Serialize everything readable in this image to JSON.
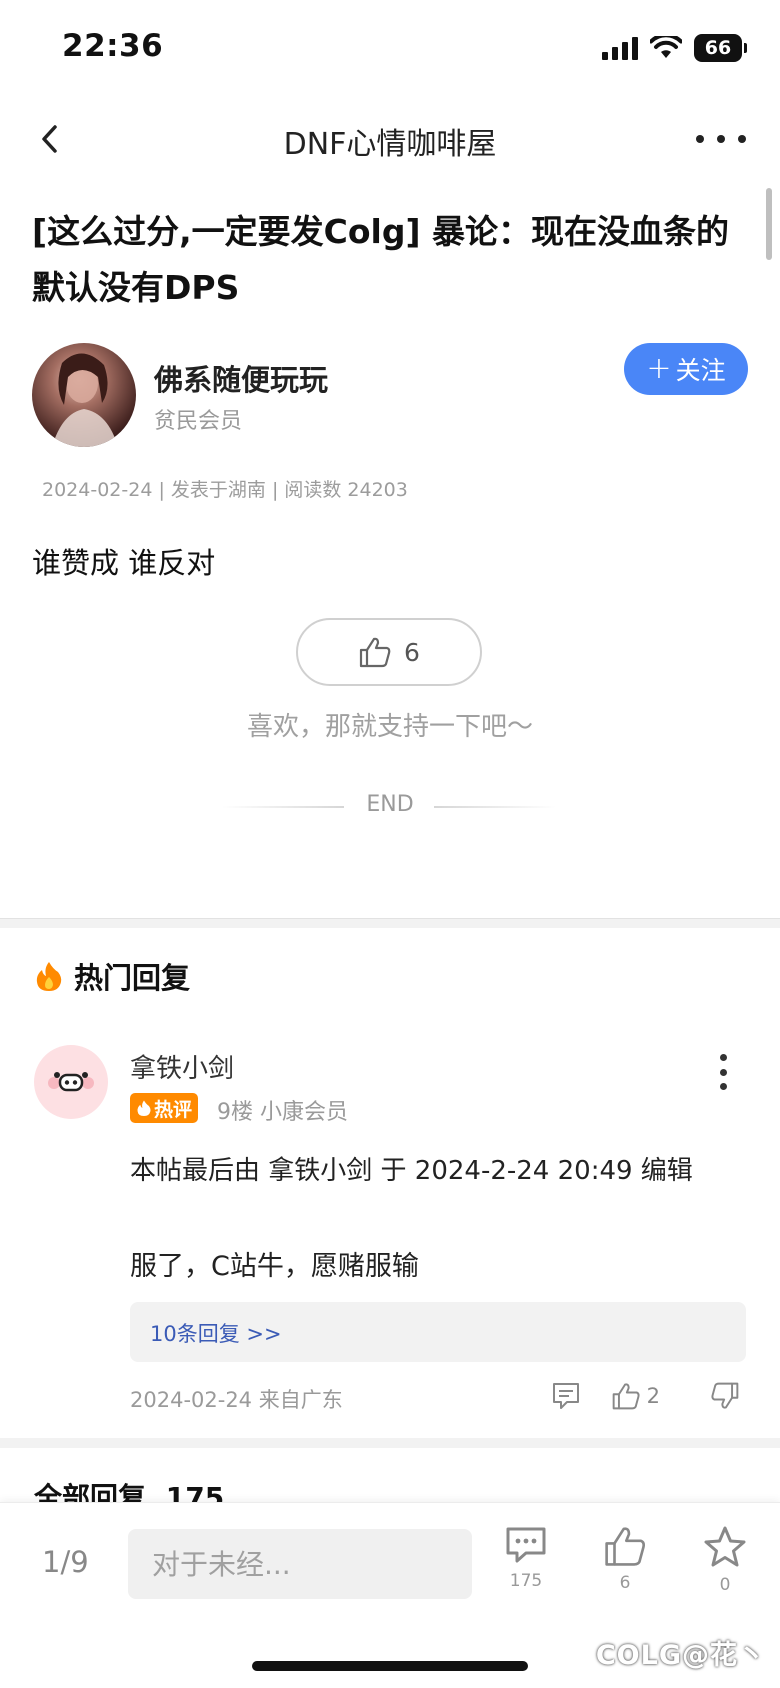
{
  "status_bar": {
    "time": "22:36",
    "battery": "66"
  },
  "nav": {
    "title": "DNF心情咖啡屋"
  },
  "post": {
    "title": "[这么过分,一定要发Colg] 暴论：现在没血条的默认没有DPS",
    "author_name": "佛系随便玩玩",
    "author_rank": "贫民会员",
    "follow_label": "关注",
    "meta": "2024-02-24 | 发表于湖南 | 阅读数 24203",
    "body": "谁赞成 谁反对",
    "like_count": "6",
    "like_hint": "喜欢，那就支持一下吧～",
    "end_label": "END"
  },
  "hot_replies": {
    "title": "热门回复",
    "items": [
      {
        "name": "拿铁小剑",
        "badge": "热评",
        "floor_rank": "9楼 小康会员",
        "edit_note": "本帖最后由 拿铁小剑 于 2024-2-24 20:49 编辑",
        "text": "服了，C站牛，愿赌服输",
        "subreplies_label": "10条回复 >>",
        "date_location": "2024-02-24 来自广东",
        "like_count": "2"
      }
    ]
  },
  "all_replies": {
    "label": "全部回复",
    "count": "175"
  },
  "bottom_bar": {
    "page_indicator": "1/9",
    "input_placeholder": "对于未经...",
    "comment_count": "175",
    "like_count": "6",
    "favorite_count": "0"
  },
  "watermark": "COLG@花丶",
  "colors": {
    "accent": "#4a86f7",
    "hot_badge": "#ff8a00",
    "link": "#3b5bb6"
  }
}
